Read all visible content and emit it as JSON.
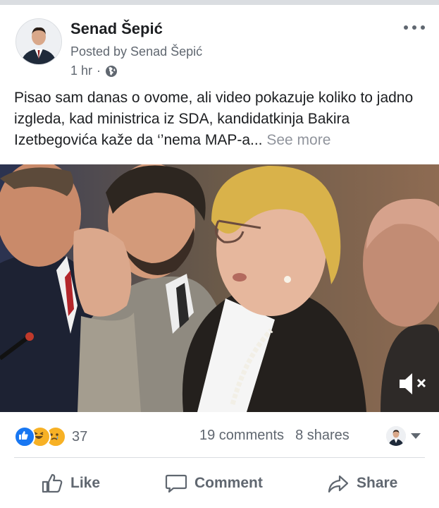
{
  "post": {
    "author": "Senad Šepić",
    "posted_by": "Posted by Senad Šepić",
    "time": "1 hr",
    "separator": "·",
    "privacy_icon": "globe-icon",
    "text": "Pisao sam danas o ovome, ali video pokazuje koliko to jadno izgleda, kad ministrica iz SDA, kandidatkinja Bakira Izetbegovića kaže da ‘’nema MAP-a...",
    "see_more": "See more"
  },
  "video": {
    "mute_icon": "speaker-muted-icon"
  },
  "stats": {
    "reactions": [
      "like",
      "haha",
      "sad"
    ],
    "reaction_count": "37",
    "comments": "19 comments",
    "shares": "8 shares"
  },
  "actions": {
    "like": "Like",
    "comment": "Comment",
    "share": "Share"
  },
  "colors": {
    "like_blue": "#1877f2",
    "reaction_yellow": "#f7b125",
    "muted_text": "#606770"
  }
}
